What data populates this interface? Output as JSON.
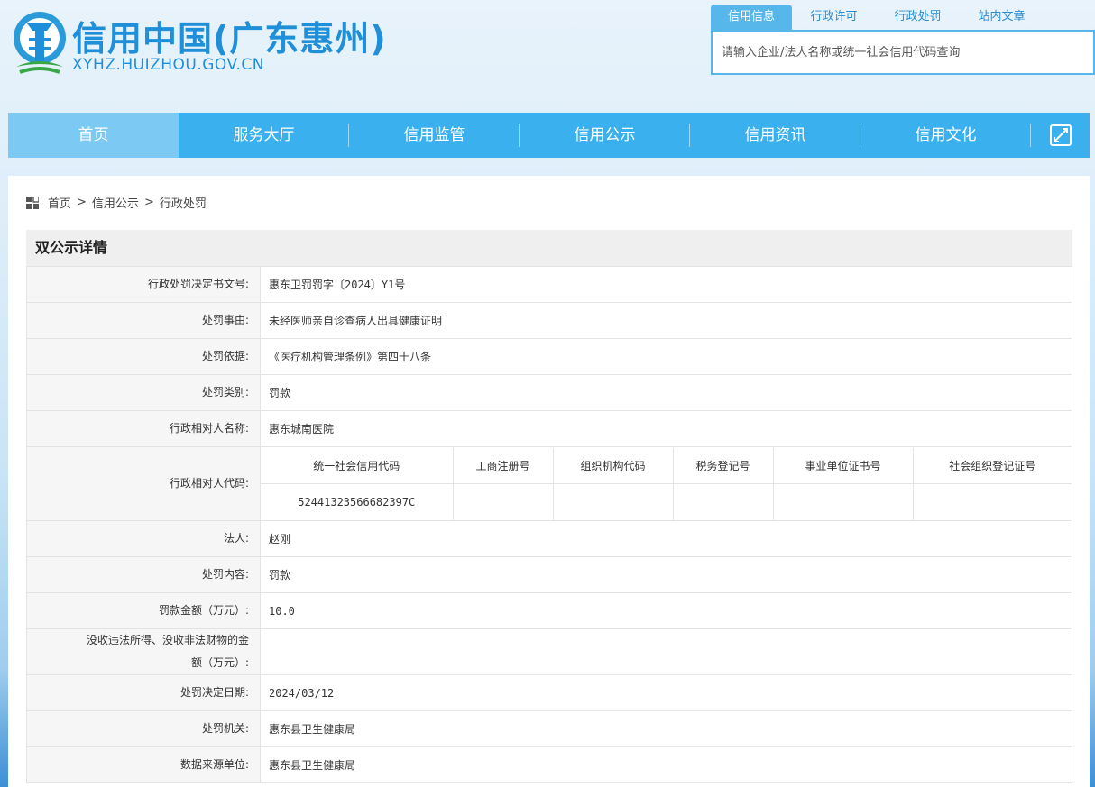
{
  "header": {
    "site_title": "信用中国(广东惠州)",
    "site_url": "XYHZ.HUIZHOU.GOV.CN"
  },
  "search": {
    "tabs": [
      "信用信息",
      "行政许可",
      "行政处罚",
      "站内文章"
    ],
    "active_tab": 0,
    "placeholder": "请输入企业/法人名称或统一社会信用代码查询"
  },
  "nav": {
    "items": [
      "首页",
      "服务大厅",
      "信用监管",
      "信用公示",
      "信用资讯",
      "信用文化"
    ],
    "active": 0
  },
  "breadcrumb": [
    "首页",
    "信用公示",
    "行政处罚"
  ],
  "detail": {
    "title": "双公示详情",
    "rows": [
      {
        "label": "行政处罚决定书文号:",
        "value": "惠东卫罚罚字〔2024〕Y1号"
      },
      {
        "label": "处罚事由:",
        "value": "未经医师亲自诊查病人出具健康证明"
      },
      {
        "label": "处罚依据:",
        "value": "《医疗机构管理条例》第四十八条"
      },
      {
        "label": "处罚类别:",
        "value": "罚款"
      },
      {
        "label": "行政相对人名称:",
        "value": "惠东城南医院"
      }
    ],
    "code_row": {
      "label": "行政相对人代码:",
      "headers": [
        "统一社会信用代码",
        "工商注册号",
        "组织机构代码",
        "税务登记号",
        "事业单位证书号",
        "社会组织登记证号"
      ],
      "values": [
        "52441323566682397C",
        "",
        "",
        "",
        "",
        ""
      ]
    },
    "rows2": [
      {
        "label": "法人:",
        "value": "赵刚"
      },
      {
        "label": "处罚内容:",
        "value": "罚款"
      },
      {
        "label": "罚款金额（万元）:",
        "value": "10.0"
      },
      {
        "label": "没收违法所得、没收非法财物的金额（万元）:",
        "value": ""
      },
      {
        "label": "处罚决定日期:",
        "value": "2024/03/12"
      },
      {
        "label": "处罚机关:",
        "value": "惠东县卫生健康局"
      },
      {
        "label": "数据来源单位:",
        "value": "惠东县卫生健康局"
      }
    ]
  }
}
